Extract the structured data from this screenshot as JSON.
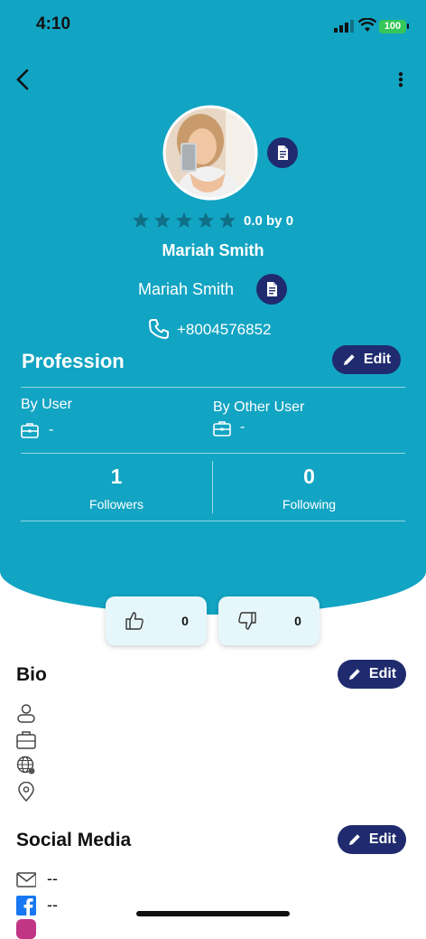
{
  "status_bar": {
    "time": "4:10",
    "battery": "100"
  },
  "profile": {
    "rating_text": "0.0 by 0",
    "name_bold": "Mariah Smith",
    "name": "Mariah Smith",
    "phone": "+8004576852"
  },
  "profession": {
    "title": "Profession",
    "edit_label": "Edit",
    "by_user_label": "By User",
    "by_user_value": "-",
    "by_other_label": "By Other User",
    "by_other_value": "-"
  },
  "stats": {
    "followers_count": "1",
    "followers_label": "Followers",
    "following_count": "0",
    "following_label": "Following"
  },
  "reactions": {
    "likes": "0",
    "dislikes": "0"
  },
  "bio": {
    "title": "Bio",
    "edit_label": "Edit"
  },
  "social": {
    "title": "Social Media",
    "edit_label": "Edit",
    "email_value": "--",
    "facebook_value": "--"
  }
}
